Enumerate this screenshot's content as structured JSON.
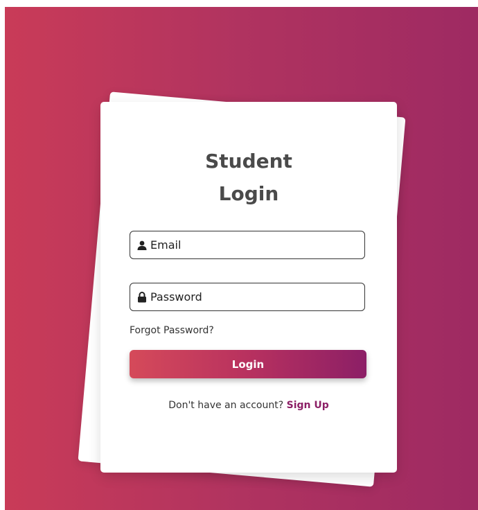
{
  "login_card": {
    "title_line1": "Student",
    "title_line2": "Login",
    "email": {
      "placeholder": "Email",
      "value": "",
      "icon": "user-icon"
    },
    "password": {
      "placeholder": "Password",
      "value": "",
      "icon": "lock-icon"
    },
    "forgot_password_link": "Forgot Password?",
    "login_button": "Login",
    "signup_prompt": "Don't have an account?",
    "signup_link": "Sign Up"
  },
  "colors": {
    "background_gradient_start": "#c93b58",
    "background_gradient_end": "#9e2a62",
    "button_gradient_start": "#d54a5a",
    "button_gradient_end": "#8c1f66",
    "accent_link": "#8c1f66",
    "title_text": "#4a4a4a"
  }
}
